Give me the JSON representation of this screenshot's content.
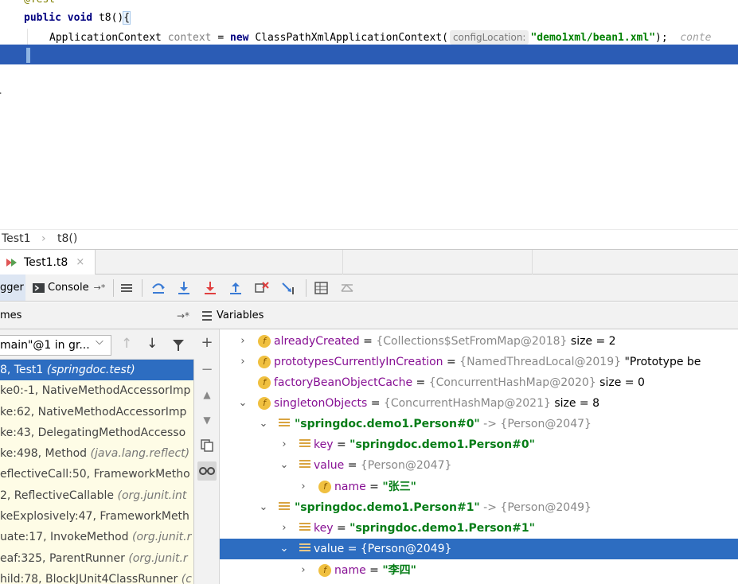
{
  "editor": {
    "line0_text": "@Test",
    "line1_kw1": "public",
    "line1_kw2": "void",
    "line1_rest": "t8()",
    "line1_brace": "{",
    "line2_type": "ApplicationContext",
    "line2_var": "context",
    "line2_eq": " = ",
    "line2_new": "new",
    "line2_ctor": "ClassPathXmlApplicationContext(",
    "line2_hint": "configLocation:",
    "line2_str": "\"demo1xml/bean1.xml\"",
    "line2_end": ");",
    "line2_ghost": "conte",
    "line3_brace": "}",
    "line5_brace": "}"
  },
  "breadcrumb": {
    "class": "Test1",
    "method": "t8()"
  },
  "tab": {
    "label": "Test1.t8",
    "close": "×"
  },
  "debug_toolbar": {
    "debugger_label": "gger",
    "console_label": "Console",
    "console_arrow": "→*"
  },
  "frames": {
    "header": "mes",
    "thread": "main\"@1 in gr...",
    "items": [
      {
        "text": "8, Test1 ",
        "pkg": "(springdoc.test)"
      },
      {
        "text": "ke0:-1, NativeMethodAccessorImp",
        "pkg": ""
      },
      {
        "text": "ke:62, NativeMethodAccessorImp",
        "pkg": ""
      },
      {
        "text": "ke:43, DelegatingMethodAccesso",
        "pkg": ""
      },
      {
        "text": "ke:498, Method ",
        "pkg": "(java.lang.reflect)"
      },
      {
        "text": "eflectiveCall:50, FrameworkMetho",
        "pkg": ""
      },
      {
        "text": "2, ReflectiveCallable ",
        "pkg": "(org.junit.int"
      },
      {
        "text": "keExplosively:47, FrameworkMeth",
        "pkg": ""
      },
      {
        "text": "uate:17, InvokeMethod ",
        "pkg": "(org.junit.r"
      },
      {
        "text": "eaf:325, ParentRunner ",
        "pkg": "(org.junit.r"
      },
      {
        "text": "hild:78, BlockJUnit4ClassRunner ",
        "pkg": "(c"
      }
    ]
  },
  "variables": {
    "header": "Variables",
    "rows": [
      {
        "name": "alreadyCreated",
        "eq": " = ",
        "type": "{Collections$SetFromMap@2018}",
        "extra": "  size = 2"
      },
      {
        "name": "prototypesCurrentlyInCreation",
        "eq": " = ",
        "type": "{NamedThreadLocal@2019}",
        "extra": " \"Prototype be"
      },
      {
        "name": "factoryBeanObjectCache",
        "eq": " = ",
        "type": "{ConcurrentHashMap@2020}",
        "extra": "  size = 0"
      },
      {
        "name": "singletonObjects",
        "eq": " = ",
        "type": "{ConcurrentHashMap@2021}",
        "extra": "  size = 8"
      },
      {
        "key": "\"springdoc.demo1.Person#0\"",
        "arrow": " -> ",
        "type": "{Person@2047}"
      },
      {
        "name": "key",
        "eq": " = ",
        "str": "\"springdoc.demo1.Person#0\""
      },
      {
        "name": "value",
        "eq": " = ",
        "type": "{Person@2047}"
      },
      {
        "name": "name",
        "eq": " = ",
        "str": "\"张三\""
      },
      {
        "key": "\"springdoc.demo1.Person#1\"",
        "arrow": " -> ",
        "type": "{Person@2049}"
      },
      {
        "name": "key",
        "eq": " = ",
        "str": "\"springdoc.demo1.Person#1\""
      },
      {
        "name": "value",
        "eq": " = ",
        "type": "{Person@2049}"
      },
      {
        "name": "name",
        "eq": " = ",
        "str": "\"李四\""
      }
    ]
  }
}
